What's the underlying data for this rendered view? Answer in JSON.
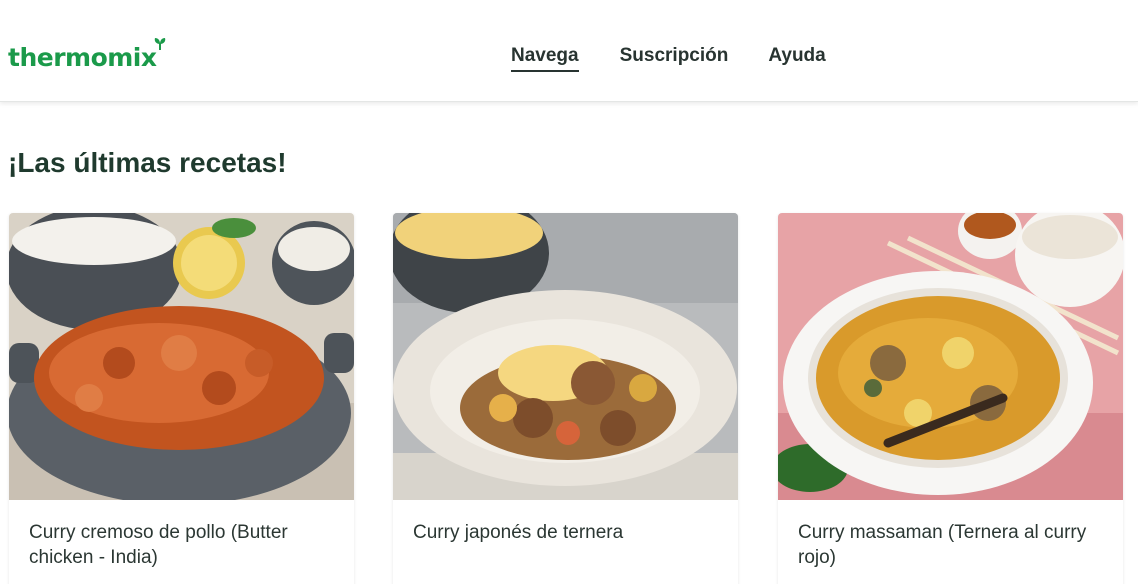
{
  "brand": {
    "logo_text": "thermomix"
  },
  "nav": {
    "items": [
      {
        "label": "Navega",
        "active": true
      },
      {
        "label": "Suscripción",
        "active": false
      },
      {
        "label": "Ayuda",
        "active": false
      }
    ]
  },
  "main": {
    "section_title": "¡Las últimas recetas!",
    "recipes": [
      {
        "title": "Curry cremoso de pollo (Butter chicken - India)"
      },
      {
        "title": "Curry japonés de ternera"
      },
      {
        "title": "Curry massaman (Ternera al curry rojo)"
      }
    ]
  },
  "colors": {
    "brand_green": "#1b9a4a",
    "heading_green": "#1f3a2e",
    "nav_text": "#283431"
  }
}
